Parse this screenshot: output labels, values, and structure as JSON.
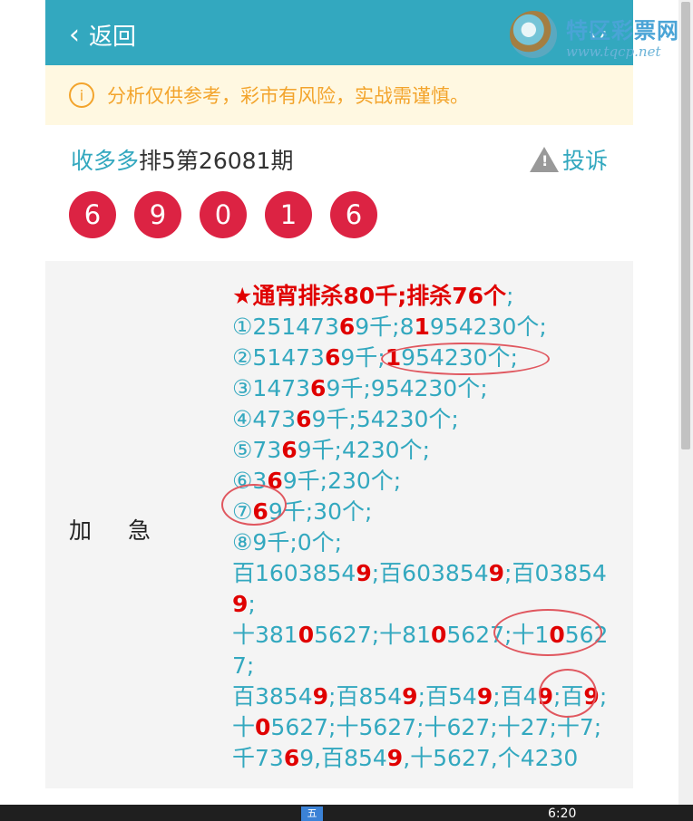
{
  "header": {
    "back_label": "返回",
    "right_icon": "partial-icon"
  },
  "watermark": {
    "name": "特区彩票网",
    "url": "www.tqcp.net"
  },
  "notice": {
    "icon": "info-icon",
    "text": "分析仅供参考，彩市有风险，实战需谨慎。"
  },
  "issue": {
    "source": "收多多",
    "title": "排5第26081期"
  },
  "complain_label": "投诉",
  "balls": [
    "6",
    "9",
    "0",
    "1",
    "6"
  ],
  "row_label": "加急",
  "lines": [
    [
      [
        "★通宵排杀80千;排杀76个",
        true
      ],
      [
        ";",
        false
      ]
    ],
    [
      [
        "①251473",
        false
      ],
      [
        "6",
        true
      ],
      [
        "9千;8",
        false
      ],
      [
        "1",
        true
      ],
      [
        "954230个;",
        false
      ]
    ],
    [
      [
        "②51473",
        false
      ],
      [
        "6",
        true
      ],
      [
        "9千;",
        false
      ],
      [
        "1",
        true
      ],
      [
        "954230个;",
        false
      ]
    ],
    [
      [
        "③1473",
        false
      ],
      [
        "6",
        true
      ],
      [
        "9千;954230个;",
        false
      ]
    ],
    [
      [
        "④473",
        false
      ],
      [
        "6",
        true
      ],
      [
        "9千;54230个;",
        false
      ]
    ],
    [
      [
        "⑤73",
        false
      ],
      [
        "6",
        true
      ],
      [
        "9千;4230个;",
        false
      ]
    ],
    [
      [
        "⑥3",
        false
      ],
      [
        "6",
        true
      ],
      [
        "9千;230个;",
        false
      ]
    ],
    [
      [
        "⑦",
        false
      ],
      [
        "6",
        true
      ],
      [
        "9千;30个;",
        false
      ]
    ],
    [
      [
        "⑧9千;0个;",
        false
      ]
    ],
    [
      [
        "百1603854",
        false
      ],
      [
        "9",
        true
      ],
      [
        ";百603854",
        false
      ],
      [
        "9",
        true
      ],
      [
        ";百03854",
        false
      ]
    ],
    [
      [
        "9",
        true
      ],
      [
        ";",
        false
      ]
    ],
    [
      [
        "十381",
        false
      ],
      [
        "0",
        true
      ],
      [
        "5627;十81",
        false
      ],
      [
        "0",
        true
      ],
      [
        "5627;十1",
        false
      ],
      [
        "0",
        true
      ],
      [
        "562",
        false
      ]
    ],
    [
      [
        "7;",
        false
      ]
    ],
    [
      [
        "百3854",
        false
      ],
      [
        "9",
        true
      ],
      [
        ";百854",
        false
      ],
      [
        "9",
        true
      ],
      [
        ";百54",
        false
      ],
      [
        "9",
        true
      ],
      [
        ";百4",
        false
      ],
      [
        "9",
        true
      ],
      [
        ";百",
        false
      ],
      [
        "9",
        true
      ],
      [
        ";",
        false
      ]
    ],
    [
      [
        "十",
        false
      ],
      [
        "0",
        true
      ],
      [
        "5627;十5627;十627;十27;十7;",
        false
      ]
    ],
    [
      [
        "千73",
        false
      ],
      [
        "6",
        true
      ],
      [
        "9,百854",
        false
      ],
      [
        "9",
        true
      ],
      [
        ",十5627,个4230",
        false
      ]
    ]
  ],
  "taskbar": {
    "app_glyph": "五",
    "clock": "6:20"
  },
  "colors": {
    "header": "#33a8bf",
    "ball": "#dc2343",
    "highlight": "#e00000",
    "text": "#33a8bf"
  }
}
